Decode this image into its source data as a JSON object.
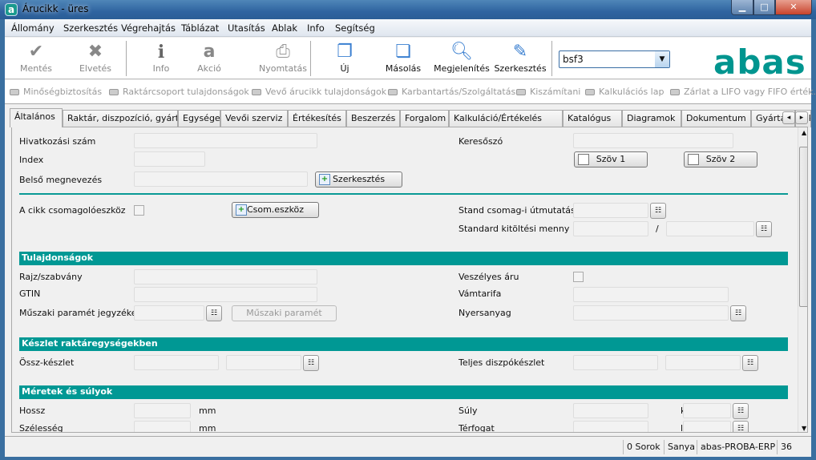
{
  "window": {
    "title": "Árucikk - üres",
    "minimize": "▁",
    "maximize": "□",
    "close": "✕"
  },
  "menu": [
    "Állomány",
    "Szerkesztés",
    "Végrehajtás",
    "Táblázat",
    "Utasítás",
    "Ablak",
    "Info",
    "Segítség"
  ],
  "toolbar": {
    "save": "Mentés",
    "discard": "Elvetés",
    "info": "Info",
    "action": "Akció",
    "print": "Nyomtatás",
    "new": "Új",
    "copy": "Másolás",
    "view": "Megjelenítés",
    "edit": "Szerkesztés",
    "combo_value": "bsf3",
    "logo": "abas"
  },
  "modules": [
    "Minőségbiztosítás",
    "Raktárcsoport tulajdonságok",
    "Vevő árucikk tulajdonságok",
    "Karbantartás/Szolgáltatás",
    "Kiszámítani",
    "Kalkulációs lap",
    "Zárlat a LIFO vagy FIFO érték..."
  ],
  "tabs": [
    "Általános",
    "Raktár, diszpozíció, gyártás",
    "Egységek",
    "Vevői szerviz",
    "Értékesítés",
    "Beszerzés",
    "Forgalom",
    "Kalkuláció/Értékelés",
    "Katalógus",
    "Diagramok",
    "Dokumentum",
    "Gyártási lista",
    "Cik"
  ],
  "form": {
    "ref_no": "Hivatkozási szám",
    "index": "Index",
    "internal_name": "Belső megnevezés",
    "edit_btn": "Szerkesztés",
    "search_word": "Keresőszó",
    "text1": "Szöv 1",
    "text2": "Szöv 2",
    "packaging": "A cikk csomagolóeszköz",
    "pack_btn": "Csom.eszköz",
    "std_pack_instr": "Stand csomag-i útmutatás",
    "std_fill_qty": "Standard kitöltési menny",
    "slash": "/",
    "sec_props": "Tulajdonságok",
    "drawing": "Rajz/szabvány",
    "gtin": "GTIN",
    "tech_param_list": "Műszaki paramét jegyzéke",
    "tech_param_btn": "Műszaki paramét",
    "dangerous": "Veszélyes áru",
    "customs": "Vámtarifa",
    "raw_material": "Nyersanyag",
    "sec_stock": "Készlet raktáregységekben",
    "total_stock": "Össz-készlet",
    "total_avail": "Teljes diszpókészlet",
    "sec_dims": "Méretek és súlyok",
    "length": "Hossz",
    "width": "Szélesség",
    "mm": "mm",
    "weight": "Súly",
    "kg": "kg/",
    "volume": "Térfogat",
    "l": "l/"
  },
  "status": {
    "rows": "0 Sorok",
    "user": "Sanya",
    "db": "abas-PROBA-ERP",
    "num": "36"
  },
  "colors": {
    "accent": "#009894"
  }
}
